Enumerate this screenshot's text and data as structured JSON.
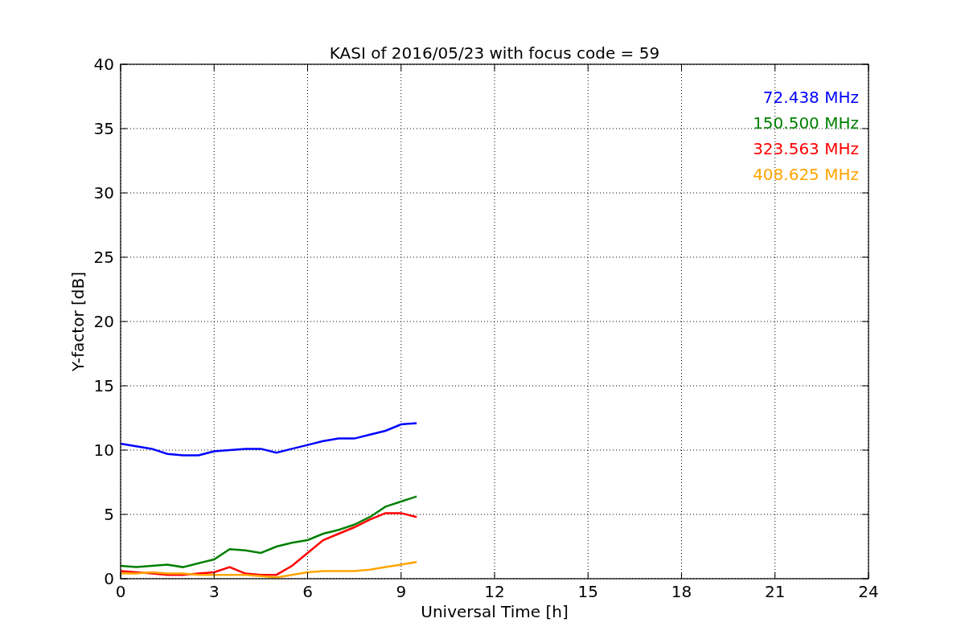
{
  "figure": {
    "chart_data": {
      "type": "line",
      "title": "KASI of 2016/05/23 with focus code = 59",
      "xlabel": "Universal Time [h]",
      "ylabel": "Y-factor [dB]",
      "x": [
        0,
        0.5,
        1,
        1.5,
        2,
        2.5,
        3,
        3.5,
        4,
        4.5,
        5,
        5.5,
        6,
        6.5,
        7,
        7.5,
        8,
        8.5,
        9,
        9.5
      ],
      "grid": true,
      "xlim": [
        0,
        24
      ],
      "ylim": [
        0,
        40
      ],
      "xticks": [
        0,
        3,
        6,
        9,
        12,
        15,
        18,
        21,
        24
      ],
      "yticks": [
        0,
        5,
        10,
        15,
        20,
        25,
        30,
        35,
        40
      ],
      "series": [
        {
          "name": "72.438 MHz",
          "color": "#0000ff",
          "values": [
            10.5,
            10.3,
            10.1,
            9.7,
            9.6,
            9.6,
            9.9,
            10.0,
            10.1,
            10.1,
            9.8,
            10.1,
            10.4,
            10.7,
            10.9,
            10.9,
            11.2,
            11.5,
            12.0,
            12.1
          ]
        },
        {
          "name": "150.500 MHz",
          "color": "#008000",
          "values": [
            1.0,
            0.9,
            1.0,
            1.1,
            0.9,
            1.2,
            1.5,
            2.3,
            2.2,
            2.0,
            2.5,
            2.8,
            3.0,
            3.5,
            3.8,
            4.2,
            4.8,
            5.6,
            6.0,
            6.4
          ]
        },
        {
          "name": "323.563 MHz",
          "color": "#ff0000",
          "values": [
            0.6,
            0.5,
            0.4,
            0.3,
            0.3,
            0.4,
            0.5,
            0.9,
            0.4,
            0.3,
            0.3,
            1.0,
            2.0,
            3.0,
            3.5,
            4.0,
            4.6,
            5.1,
            5.1,
            4.8
          ]
        },
        {
          "name": "408.625 MHz",
          "color": "#ffa500",
          "values": [
            0.4,
            0.4,
            0.5,
            0.4,
            0.4,
            0.3,
            0.3,
            0.3,
            0.3,
            0.2,
            0.1,
            0.3,
            0.5,
            0.6,
            0.6,
            0.6,
            0.7,
            0.9,
            1.1,
            1.3
          ]
        }
      ]
    }
  }
}
